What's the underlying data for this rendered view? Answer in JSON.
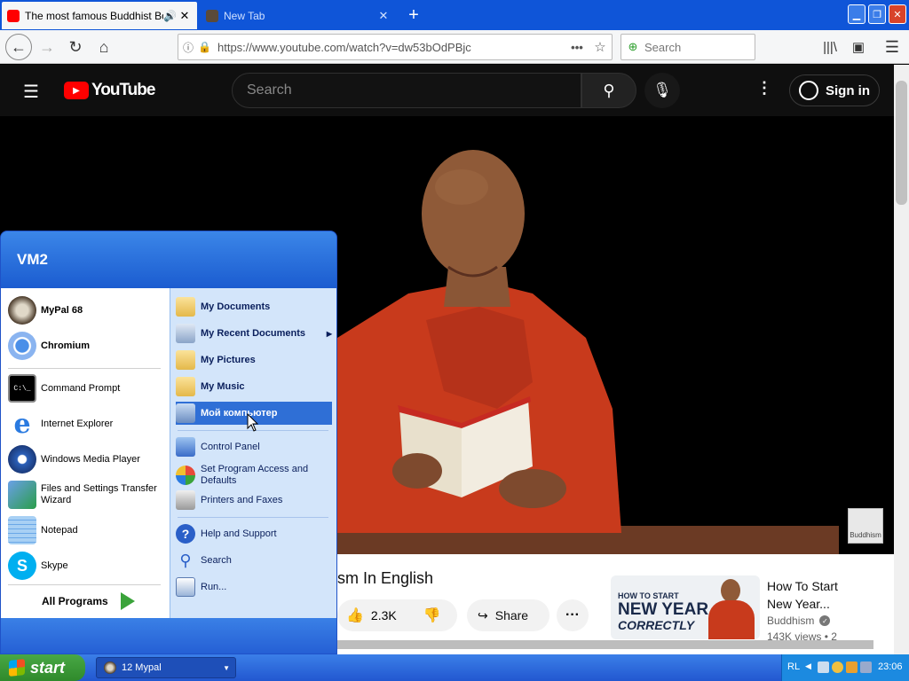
{
  "browser": {
    "tabs": [
      {
        "title": "The most famous Buddhist Boo",
        "active": true
      },
      {
        "title": "New Tab",
        "active": false
      }
    ],
    "url": "https://www.youtube.com/watch?v=dw53bOdPBjc",
    "search_placeholder": "Search",
    "new_tab_symbol": "+"
  },
  "youtube": {
    "logo": "YouTube",
    "search_placeholder": "Search",
    "sign_in": "Sign in",
    "video_title_partial": "sm In English",
    "likes": "2.3K",
    "share": "Share",
    "watermark": "Buddhism",
    "suggested": {
      "title_line1": "How To Start",
      "title_line2": "New Year...",
      "channel": "Buddhism",
      "meta": "143K views • 2",
      "thumb_line1": "HOW TO START",
      "thumb_line2": "NEW YEAR",
      "thumb_line3": "CORRECTLY"
    }
  },
  "start_menu": {
    "user": "VM2",
    "pinned": [
      {
        "label": "MyPal 68",
        "icon": "mypal-icon"
      },
      {
        "label": "Chromium",
        "icon": "chromium-icon"
      }
    ],
    "recent": [
      {
        "label": "Command Prompt",
        "icon": "cmd-icon"
      },
      {
        "label": "Internet Explorer",
        "icon": "ie-icon"
      },
      {
        "label": "Windows Media Player",
        "icon": "wmp-icon"
      },
      {
        "label": "Files and Settings Transfer Wizard",
        "icon": "transfer-icon"
      },
      {
        "label": "Notepad",
        "icon": "notepad-icon"
      },
      {
        "label": "Skype",
        "icon": "skype-icon"
      }
    ],
    "all_programs": "All Programs",
    "right_items": [
      {
        "label": "My Documents"
      },
      {
        "label": "My Recent Documents"
      },
      {
        "label": "My Pictures"
      },
      {
        "label": "My Music"
      },
      {
        "label": "Мой компьютер"
      }
    ],
    "right_items2": [
      {
        "label": "Control Panel"
      },
      {
        "label": "Set Program Access and Defaults"
      },
      {
        "label": "Printers and Faxes"
      }
    ],
    "right_items3": [
      {
        "label": "Help and Support"
      },
      {
        "label": "Search"
      },
      {
        "label": "Run..."
      }
    ]
  },
  "taskbar": {
    "start": "start",
    "task": "12 Mypal",
    "lang": "RL",
    "clock": "23:06"
  },
  "colors": {
    "xp_blue": "#2d66dc",
    "yt_red": "#ff0000",
    "robe": "#c83a1c"
  }
}
